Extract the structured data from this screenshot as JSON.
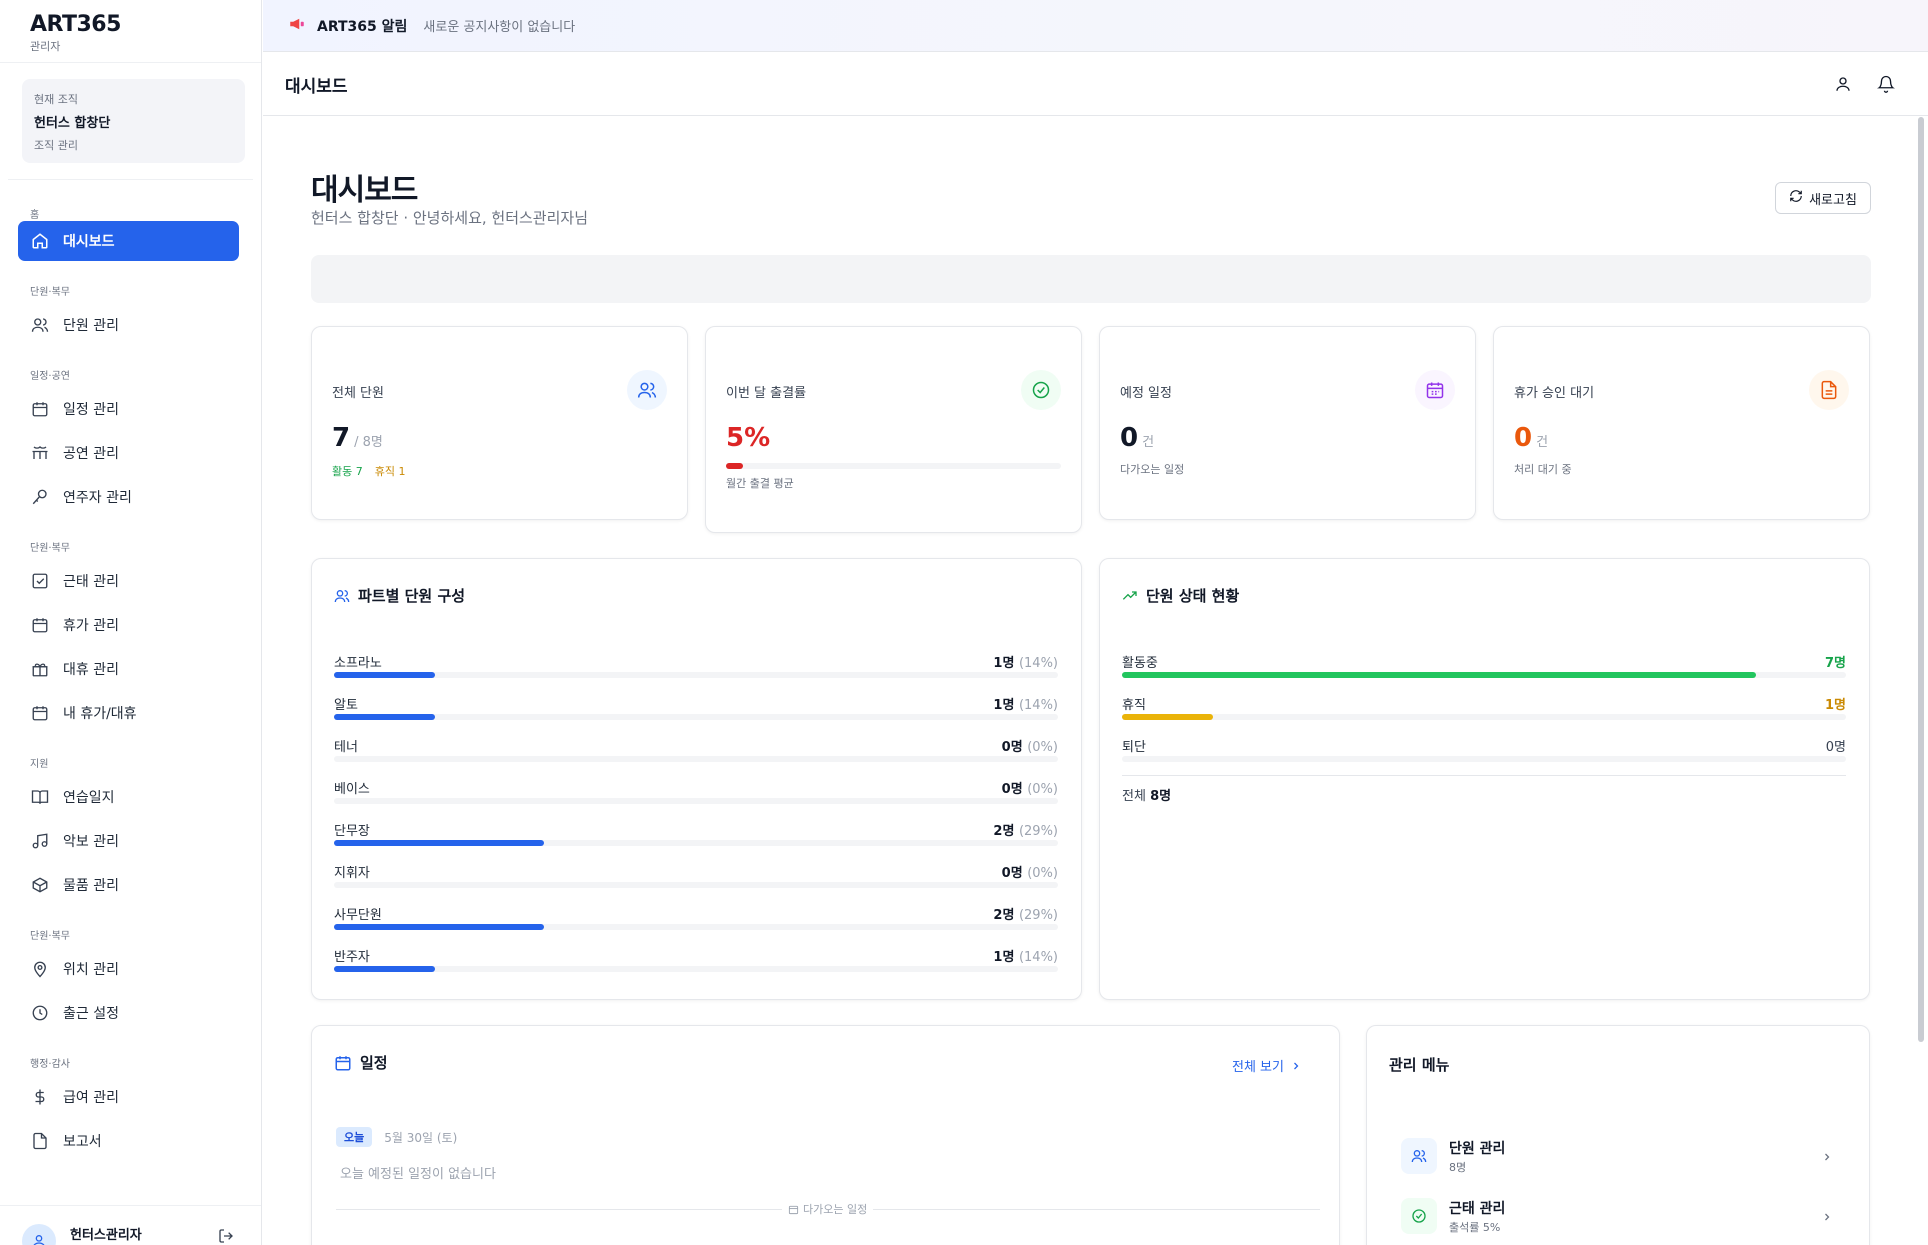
{
  "brand": {
    "name": "ART365",
    "sub": "관리자"
  },
  "org": {
    "label": "현재 조직",
    "name": "헌터스 합창단",
    "manage": "조직 관리"
  },
  "nav": {
    "s_home": "홈",
    "dashboard": "대시보드",
    "s_members": "단원·복무",
    "members": "단원 관리",
    "s_schedule": "일정·공연",
    "schedule": "일정 관리",
    "performance": "공연 관리",
    "performers": "연주자 관리",
    "s_service": "단원·복무",
    "attendance": "근태 관리",
    "leave": "휴가 관리",
    "substitute": "대휴 관리",
    "my_leave": "내 휴가/대휴",
    "s_support": "지원",
    "practice_log": "연습일지",
    "score": "악보 관리",
    "goods": "물품 관리",
    "s_service2": "단원·복무",
    "location": "위치 관리",
    "checkin": "출근 설정",
    "s_admin": "행정·감사",
    "payroll": "급여 관리",
    "report": "보고서"
  },
  "user": {
    "name": "헌터스관리자"
  },
  "notice": {
    "title": "ART365 알림",
    "text": "새로운 공지사항이 없습니다"
  },
  "topbar": {
    "title": "대시보드"
  },
  "page": {
    "title": "대시보드",
    "subtitle": "헌터스 합창단 · 안녕하세요, 헌터스관리자님",
    "refresh": "새로고침"
  },
  "stats": {
    "members": {
      "label": "전체 단원",
      "value": "7",
      "total": "/ 8명",
      "active": "활동 7",
      "rest": "휴직 1"
    },
    "attendance": {
      "label": "이번 달 출결률",
      "value": "5%",
      "progress": 5,
      "note": "월간 출결 평균"
    },
    "schedule": {
      "label": "예정 일정",
      "value": "0",
      "unit": "건",
      "note": "다가오는 일정"
    },
    "leave": {
      "label": "휴가 승인 대기",
      "value": "0",
      "unit": "건",
      "note": "처리 대기 중"
    }
  },
  "parts": {
    "title": "파트별 단원 구성",
    "rows": [
      {
        "name": "소프라노",
        "count": "1명",
        "pct": "(14%)",
        "value": 14
      },
      {
        "name": "알토",
        "count": "1명",
        "pct": "(14%)",
        "value": 14
      },
      {
        "name": "테너",
        "count": "0명",
        "pct": "(0%)",
        "value": 0
      },
      {
        "name": "베이스",
        "count": "0명",
        "pct": "(0%)",
        "value": 0
      },
      {
        "name": "단무장",
        "count": "2명",
        "pct": "(29%)",
        "value": 29
      },
      {
        "name": "지휘자",
        "count": "0명",
        "pct": "(0%)",
        "value": 0
      },
      {
        "name": "사무단원",
        "count": "2명",
        "pct": "(29%)",
        "value": 29
      },
      {
        "name": "반주자",
        "count": "1명",
        "pct": "(14%)",
        "value": 14
      }
    ]
  },
  "status": {
    "title": "단원 상태 현황",
    "rows": [
      {
        "name": "활동중",
        "count": "7명",
        "value": 87.5,
        "color": "#22c55e",
        "text_color": "#16a34a"
      },
      {
        "name": "휴직",
        "count": "1명",
        "value": 12.5,
        "color": "#eab308",
        "text_color": "#ca8a04"
      },
      {
        "name": "퇴단",
        "count": "0명",
        "value": 0,
        "color": "#9ca3af",
        "text_color": "#374151"
      }
    ],
    "total_label": "전체",
    "total_value": "8명"
  },
  "schedule_card": {
    "title": "일정",
    "view_all": "전체 보기",
    "today_badge": "오늘",
    "today_date": "5월 30일 (토)",
    "empty": "오늘 예정된 일정이 없습니다",
    "upcoming": "다가오는 일정"
  },
  "admin_menu": {
    "title": "관리 메뉴",
    "items": [
      {
        "title": "단원 관리",
        "sub": "8명"
      },
      {
        "title": "근태 관리",
        "sub": "출석률 5%"
      }
    ]
  },
  "colors": {
    "accent": "#2563eb",
    "danger": "#dc2626",
    "orange": "#ea580c"
  }
}
